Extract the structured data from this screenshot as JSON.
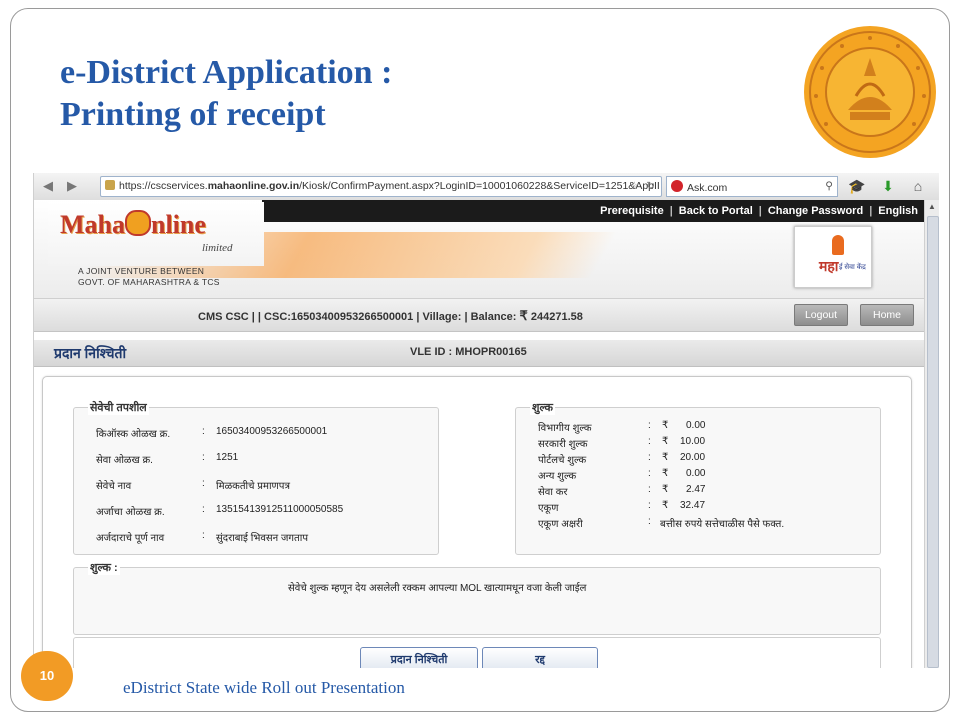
{
  "slide": {
    "title_line1": "e-District  Application :",
    "title_line2": "Printing  of receipt",
    "page_number": "10",
    "footer": "eDistrict  State wide Roll out Presentation",
    "emblem": "maharashtra-seal-emblem"
  },
  "browser": {
    "url_prefix": "https://cscservices.",
    "url_domain": "mahaonline.gov.in",
    "url_rest": "/Kiosk/ConfirmPayment.aspx?LoginID=10001060228&ServiceID=1251&AppII",
    "search_text": "Ask.com",
    "icons": [
      "back-icon",
      "forward-icon",
      "lock-icon",
      "star-icon",
      "refresh-icon",
      "ask-icon",
      "search-icon",
      "graduation-cap-icon",
      "download-arrow-icon",
      "home-icon"
    ]
  },
  "site": {
    "logo_text_left": "Maha",
    "logo_text_right": "nline",
    "logo_limited": "limited",
    "jv_line1": "A JOINT VENTURE BETWEEN",
    "jv_line2": "GOVT. OF MAHARASHTRA & TCS",
    "top_links": [
      "Prerequisite",
      "Back to Portal",
      "Change Password",
      "English"
    ],
    "right_logo_text": "महा",
    "right_logo_sub": "ई सेवा केंद्र"
  },
  "info_bar": {
    "text_part1": "CMS CSC |     | CSC:16503400953266500001 | Village:    | Balance: ",
    "currency": "₹",
    "balance": "244271.58",
    "logout": "Logout",
    "home": "Home"
  },
  "section": {
    "title": "प्रदान निश्चिती",
    "vle": "VLE ID : MHOPR00165"
  },
  "details": {
    "legend": "सेवेची तपशील",
    "rows": [
      {
        "label": "किऑस्क ओळख क्र.",
        "value": "16503400953266500001"
      },
      {
        "label": "सेवा ओळख क्र.",
        "value": "1251"
      },
      {
        "label": "सेवेचे नाव",
        "value": "मिळकतीचे प्रमाणपत्र"
      },
      {
        "label": "अर्जाचा ओळख क्र.",
        "value": "13515413912511000050585"
      },
      {
        "label": "अर्जदाराचे पूर्ण नाव",
        "value": "सुंदराबाई भिवसन जगताप"
      }
    ]
  },
  "fees": {
    "legend": "शुल्क",
    "currency": "₹",
    "rows": [
      {
        "label": "विभागीय शुल्क",
        "value": "0.00"
      },
      {
        "label": "सरकारी शुल्क",
        "value": "10.00"
      },
      {
        "label": "पोर्टलचे शुल्क",
        "value": "20.00"
      },
      {
        "label": "अन्य शुल्क",
        "value": "0.00"
      },
      {
        "label": "सेवा कर",
        "value": "2.47"
      },
      {
        "label": "एकूण",
        "value": "32.47"
      }
    ],
    "words_label": "एकूण अक्षरी",
    "words_value": "बत्तीस रुपये सत्तेचाळीस पैसे फक्त."
  },
  "note": {
    "legend": "शुल्क :",
    "text": "सेवेचे शुल्क म्हणून देय असलेली रक्कम आपल्या MOL खात्यामधून वजा केली जाईल"
  },
  "buttons": {
    "confirm": "प्रदान निश्चिती",
    "cancel": "रद्द"
  }
}
